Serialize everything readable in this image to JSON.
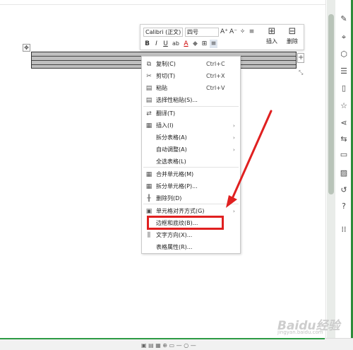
{
  "document": {
    "move_icon": "move-icon",
    "add_col_symbol": "+",
    "resize_icon": "resize-icon"
  },
  "toolbar": {
    "font_name": "Calibri (正文)",
    "font_size": "四号",
    "grow_font": "A⁺",
    "shrink_font": "A⁻",
    "format_painter": "✧",
    "para_spacing": "≡",
    "bold": "B",
    "italic": "I",
    "underline": "U",
    "highlight": "ab",
    "font_color": "A",
    "shading": "◆",
    "border": "⊞",
    "align": "≡",
    "insert_label": "插入",
    "delete_label": "删除"
  },
  "menu": {
    "items": [
      {
        "icon": "copy-icon",
        "glyph": "⧉",
        "label": "复制(C)",
        "shortcut": "Ctrl+C",
        "arrow": ""
      },
      {
        "icon": "cut-icon",
        "glyph": "✂",
        "label": "剪切(T)",
        "shortcut": "Ctrl+X",
        "arrow": ""
      },
      {
        "icon": "paste-icon",
        "glyph": "▤",
        "label": "粘贴",
        "shortcut": "Ctrl+V",
        "arrow": ""
      },
      {
        "icon": "paste-special-icon",
        "glyph": "▤",
        "label": "选择性粘贴(S)...",
        "shortcut": "",
        "arrow": ""
      },
      {
        "icon": "translate-icon",
        "glyph": "⇄",
        "label": "翻译(T)",
        "shortcut": "",
        "arrow": ""
      },
      {
        "icon": "insert-icon",
        "glyph": "▦",
        "label": "插入(I)",
        "shortcut": "",
        "arrow": "›"
      },
      {
        "icon": "",
        "glyph": "",
        "label": "拆分表格(A)",
        "shortcut": "",
        "arrow": "›"
      },
      {
        "icon": "",
        "glyph": "",
        "label": "自动调整(A)",
        "shortcut": "",
        "arrow": "›"
      },
      {
        "icon": "",
        "glyph": "",
        "label": "全选表格(L)",
        "shortcut": "",
        "arrow": ""
      },
      {
        "icon": "merge-cells-icon",
        "glyph": "▦",
        "label": "合并单元格(M)",
        "shortcut": "",
        "arrow": ""
      },
      {
        "icon": "split-cells-icon",
        "glyph": "▦",
        "label": "拆分单元格(P)...",
        "shortcut": "",
        "arrow": ""
      },
      {
        "icon": "delete-column-icon",
        "glyph": "╫",
        "label": "删除列(D)",
        "shortcut": "",
        "arrow": ""
      },
      {
        "icon": "cell-align-icon",
        "glyph": "▣",
        "label": "单元格对齐方式(G)",
        "shortcut": "",
        "arrow": "›"
      },
      {
        "icon": "",
        "glyph": "",
        "label": "边框和底纹(B)...",
        "shortcut": "",
        "arrow": ""
      },
      {
        "icon": "text-direction-icon",
        "glyph": "⫼",
        "label": "文字方向(X)...",
        "shortcut": "",
        "arrow": ""
      },
      {
        "icon": "",
        "glyph": "",
        "label": "表格属性(R)...",
        "shortcut": "",
        "arrow": ""
      }
    ]
  },
  "sidebar": {
    "icons": [
      "pen-icon",
      "select-icon",
      "shapes-icon",
      "adjust-icon",
      "doc-icon",
      "star-icon",
      "share-icon",
      "compare-icon",
      "archive-icon",
      "image-icon",
      "history-icon",
      "help-icon",
      "grid-icon"
    ],
    "glyphs": [
      "✎",
      "⌖",
      "⬡",
      "☰",
      "▯",
      "☆",
      "⋖",
      "⇆",
      "▭",
      "▨",
      "↺",
      "?",
      "⁞⁞"
    ]
  },
  "status_bar": {
    "text": "▣  ▤  ▦  ⊕  ▭  —  ○  —"
  },
  "watermark": {
    "brand": "Baidu经验",
    "url": "jingyan.baidu.com"
  },
  "colors": {
    "annotation_red": "#e02020",
    "accent_green": "#2e8b3a"
  }
}
